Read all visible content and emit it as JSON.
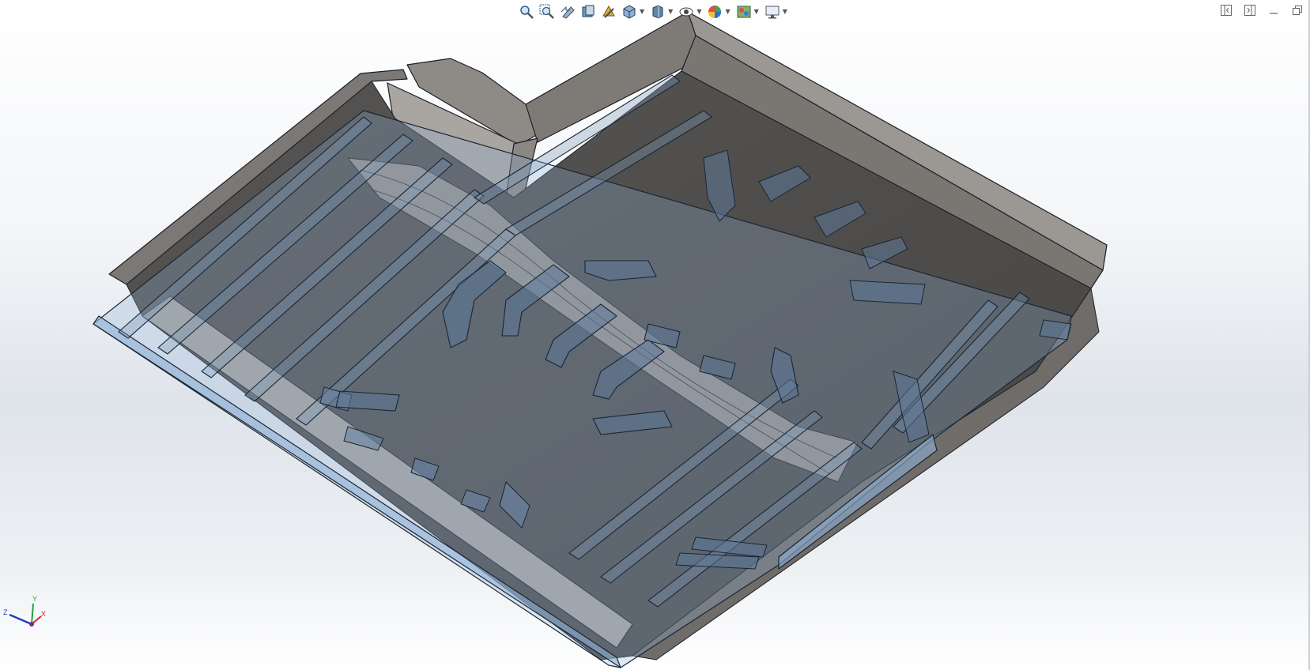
{
  "viewport": {
    "background_top": "#ffffff",
    "background_mid": "#dfe4ea",
    "part_color": "#7a7773",
    "part_dark": "#4f4d4b",
    "part_light": "#a39f9a",
    "transparent_body_color": "#8fb1d6",
    "edge_color": "#1b1f24"
  },
  "heads_up_toolbar": {
    "buttons": [
      {
        "icon": "zoom-to-fit-icon"
      },
      {
        "icon": "zoom-to-area-icon"
      },
      {
        "icon": "previous-view-icon"
      },
      {
        "icon": "section-view-icon"
      },
      {
        "icon": "dynamic-annotation-views-icon"
      },
      {
        "icon": "view-orientation-icon",
        "dropdown": true
      },
      {
        "icon": "display-style-icon",
        "dropdown": true
      },
      {
        "icon": "hide-show-items-icon",
        "dropdown": true
      },
      {
        "icon": "edit-appearance-icon",
        "dropdown": true
      },
      {
        "icon": "apply-scene-icon",
        "dropdown": true
      },
      {
        "icon": "view-settings-icon",
        "dropdown": true
      }
    ]
  },
  "window_controls": [
    {
      "icon": "tile-left-icon"
    },
    {
      "icon": "tile-right-icon"
    },
    {
      "icon": "minimize-icon"
    },
    {
      "icon": "restore-icon"
    }
  ],
  "triad": {
    "x_label": "X",
    "y_label": "Y",
    "z_label": "Z",
    "x_color": "#d2232a",
    "y_color": "#2aa03a",
    "z_color": "#1f3fbf"
  }
}
